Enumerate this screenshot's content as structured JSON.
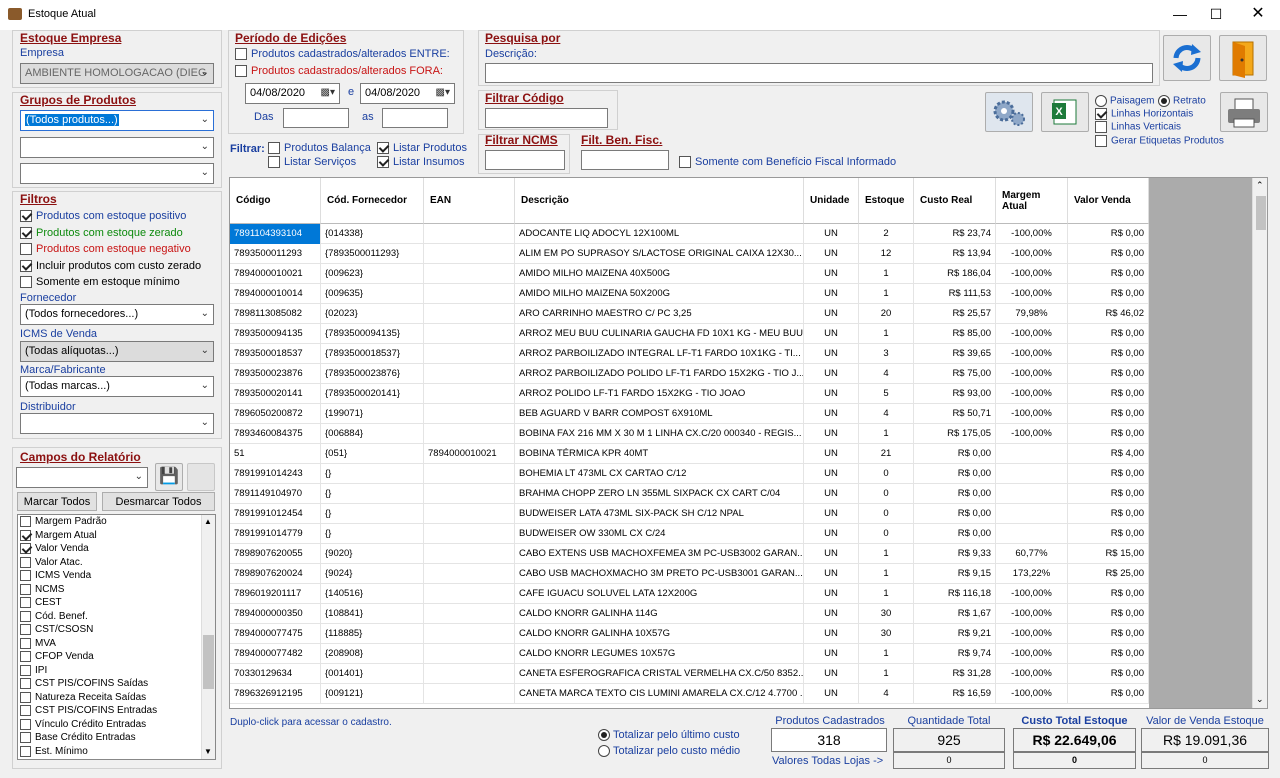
{
  "window": {
    "title": "Estoque Atual"
  },
  "empresa": {
    "section": "Estoque Empresa",
    "label": "Empresa",
    "value": "AMBIENTE HOMOLOGACAO (DIEG"
  },
  "grupos": {
    "section": "Grupos de Produtos",
    "combo1": "(Todos produtos...)",
    "combo2": "",
    "combo3": ""
  },
  "filtros": {
    "section": "Filtros",
    "items": [
      {
        "label": "Produtos com estoque positivo",
        "checked": true,
        "color": "#1a3fa0"
      },
      {
        "label": "Produtos com estoque zerado",
        "checked": true,
        "color": "#0d8a0d"
      },
      {
        "label": "Produtos com estoque negativo",
        "checked": false,
        "color": "#c81414"
      },
      {
        "label": "Incluir produtos com custo zerado",
        "checked": true,
        "color": "#000000"
      },
      {
        "label": "Somente em estoque mínimo",
        "checked": false,
        "color": "#000000"
      }
    ],
    "fornecedor_label": "Fornecedor",
    "fornecedor": "(Todos fornecedores...)",
    "icms_label": "ICMS de Venda",
    "icms": "(Todas alíquotas...)",
    "marca_label": "Marca/Fabricante",
    "marca": "(Todas marcas...)",
    "distribuidor_label": "Distribuidor",
    "distribuidor": ""
  },
  "campos": {
    "section": "Campos do Relatório",
    "marcar": "Marcar Todos",
    "desmarcar": "Desmarcar Todos",
    "items": [
      {
        "label": "Margem Padrão",
        "checked": false
      },
      {
        "label": "Margem Atual",
        "checked": true
      },
      {
        "label": "Valor Venda",
        "checked": true
      },
      {
        "label": "Valor Atac.",
        "checked": false
      },
      {
        "label": "ICMS Venda",
        "checked": false
      },
      {
        "label": "NCMS",
        "checked": false
      },
      {
        "label": "CEST",
        "checked": false
      },
      {
        "label": "Cód. Benef.",
        "checked": false
      },
      {
        "label": "CST/CSOSN",
        "checked": false
      },
      {
        "label": "MVA",
        "checked": false
      },
      {
        "label": "CFOP Venda",
        "checked": false
      },
      {
        "label": "IPI",
        "checked": false
      },
      {
        "label": "CST PIS/COFINS Saídas",
        "checked": false
      },
      {
        "label": "Natureza Receita Saídas",
        "checked": false
      },
      {
        "label": "CST PIS/COFINS Entradas",
        "checked": false
      },
      {
        "label": "Vínculo Crédito Entradas",
        "checked": false
      },
      {
        "label": "Base Crédito Entradas",
        "checked": false
      },
      {
        "label": "Est. Mínimo",
        "checked": false
      }
    ]
  },
  "periodo": {
    "section": "Período de Edições",
    "entre": "Produtos cadastrados/alterados ENTRE:",
    "fora": "Produtos cadastrados/alterados FORA:",
    "date1": "04/08/2020",
    "e": "e",
    "date2": "04/08/2020",
    "das": "Das",
    "as": "as"
  },
  "filtrar": {
    "label": "Filtrar:",
    "balanca": "Produtos Balança",
    "servicos": "Listar Serviços",
    "listar_produtos": "Listar Produtos",
    "insumos": "Listar Insumos"
  },
  "pesquisa": {
    "section": "Pesquisa por",
    "descricao_label": "Descrição:",
    "descricao": ""
  },
  "filtrar_codigo": {
    "label": "Filtrar Código",
    "value": ""
  },
  "filtrar_ncms": {
    "label": "Filtrar NCMS",
    "value": ""
  },
  "filt_ben": {
    "label": "Filt. Ben. Fisc.",
    "value": "",
    "somente": "Somente com Benefício Fiscal Informado"
  },
  "opcoes": {
    "paisagem": "Paisagem",
    "retrato": "Retrato",
    "linhas_h": "Linhas Horizontais",
    "linhas_v": "Linhas Verticais",
    "etiquetas": "Gerar Etiquetas Produtos"
  },
  "grid": {
    "headers": [
      "Código",
      "Cód. Fornecedor",
      "EAN",
      "Descrição",
      "Unidade",
      "Estoque",
      "Custo Real",
      "Margem Atual",
      "Valor Venda"
    ],
    "rows": [
      [
        "7891104393104",
        "{014338}",
        "",
        "ADOCANTE LIQ ADOCYL          12X100ML",
        "UN",
        "2",
        "R$ 23,74",
        "-100,00%",
        "R$ 0,00"
      ],
      [
        "7893500011293",
        "{7893500011293}",
        "",
        "ALIM EM PO SUPRASOY S/LACTOSE ORIGINAL CAIXA 12X30...",
        "UN",
        "12",
        "R$ 13,94",
        "-100,00%",
        "R$ 0,00"
      ],
      [
        "7894000010021",
        "{009623}",
        "",
        "AMIDO MILHO MAIZENA            40X500G",
        "UN",
        "1",
        "R$ 186,04",
        "-100,00%",
        "R$ 0,00"
      ],
      [
        "7894000010014",
        "{009635}",
        "",
        "AMIDO MILHO MAIZENA            50X200G",
        "UN",
        "1",
        "R$ 111,53",
        "-100,00%",
        "R$ 0,00"
      ],
      [
        "7898113085082",
        "{02023}",
        "",
        "ARO CARRINHO MAESTRO C/ PC 3,25",
        "UN",
        "20",
        "R$ 25,57",
        "79,98%",
        "R$ 46,02"
      ],
      [
        "7893500094135",
        "{7893500094135}",
        "",
        "ARROZ MEU BUU CULINARIA GAUCHA FD 10X1 KG - MEU BUU",
        "UN",
        "1",
        "R$ 85,00",
        "-100,00%",
        "R$ 0,00"
      ],
      [
        "7893500018537",
        "{7893500018537}",
        "",
        "ARROZ PARBOILIZADO INTEGRAL LF-T1 FARDO 10X1KG - TI...",
        "UN",
        "3",
        "R$ 39,65",
        "-100,00%",
        "R$ 0,00"
      ],
      [
        "7893500023876",
        "{7893500023876}",
        "",
        "ARROZ PARBOILIZADO POLIDO LF-T1 FARDO 15X2KG - TIO J...",
        "UN",
        "4",
        "R$ 75,00",
        "-100,00%",
        "R$ 0,00"
      ],
      [
        "7893500020141",
        "{7893500020141}",
        "",
        "ARROZ POLIDO LF-T1 FARDO 15X2KG - TIO JOAO",
        "UN",
        "5",
        "R$ 93,00",
        "-100,00%",
        "R$ 0,00"
      ],
      [
        "7896050200872",
        "{199071}",
        "",
        "BEB AGUARD V BARR  COMPOST     6X910ML",
        "UN",
        "4",
        "R$ 50,71",
        "-100,00%",
        "R$ 0,00"
      ],
      [
        "7893460084375",
        "{006884}",
        "",
        "BOBINA FAX 216 MM X 30 M 1 LINHA CX.C/20 000340 - REGIS...",
        "UN",
        "1",
        "R$ 175,05",
        "-100,00%",
        "R$ 0,00"
      ],
      [
        "51",
        "{051}",
        "7894000010021",
        "BOBINA TÉRMICA KPR 40MT",
        "UN",
        "21",
        "R$ 0,00",
        "",
        "R$ 4,00"
      ],
      [
        "7891991014243",
        "{}",
        "",
        "BOHEMIA LT 473ML CX CARTAO C/12",
        "UN",
        "0",
        "R$ 0,00",
        "",
        "R$ 0,00"
      ],
      [
        "7891149104970",
        "{}",
        "",
        "BRAHMA CHOPP ZERO LN 355ML SIXPACK CX CART C/04",
        "UN",
        "0",
        "R$ 0,00",
        "",
        "R$ 0,00"
      ],
      [
        "7891991012454",
        "{}",
        "",
        "BUDWEISER LATA 473ML SIX-PACK SH C/12 NPAL",
        "UN",
        "0",
        "R$ 0,00",
        "",
        "R$ 0,00"
      ],
      [
        "7891991014779",
        "{}",
        "",
        "BUDWEISER OW 330ML CX C/24",
        "UN",
        "0",
        "R$ 0,00",
        "",
        "R$ 0,00"
      ],
      [
        "7898907620055",
        "{9020}",
        "",
        "CABO EXTENS USB MACHOXFEMEA 3M PC-USB3002 GARAN...",
        "UN",
        "1",
        "R$ 9,33",
        "60,77%",
        "R$ 15,00"
      ],
      [
        "7898907620024",
        "{9024}",
        "",
        "CABO USB MACHOXMACHO 3M PRETO PC-USB3001 GARAN...",
        "UN",
        "1",
        "R$ 9,15",
        "173,22%",
        "R$ 25,00"
      ],
      [
        "7896019201117",
        "{140516}",
        "",
        "CAFE IGUACU SOLUVEL LATA       12X200G",
        "UN",
        "1",
        "R$ 116,18",
        "-100,00%",
        "R$ 0,00"
      ],
      [
        "7894000000350",
        "{108841}",
        "",
        "CALDO KNORR GALINHA            114G",
        "UN",
        "30",
        "R$ 1,67",
        "-100,00%",
        "R$ 0,00"
      ],
      [
        "7894000077475",
        "{118885}",
        "",
        "CALDO KNORR GALINHA            10X57G",
        "UN",
        "30",
        "R$ 9,21",
        "-100,00%",
        "R$ 0,00"
      ],
      [
        "7894000077482",
        "{208908}",
        "",
        "CALDO KNORR LEGUMES            10X57G",
        "UN",
        "1",
        "R$ 9,74",
        "-100,00%",
        "R$ 0,00"
      ],
      [
        "70330129634",
        "{001401}",
        "",
        "CANETA ESFEROGRAFICA CRISTAL VERMELHA CX.C/50 8352...",
        "UN",
        "1",
        "R$ 31,28",
        "-100,00%",
        "R$ 0,00"
      ],
      [
        "7896326912195",
        "{009121}",
        "",
        "CANETA MARCA TEXTO CIS LUMINI AMARELA CX.C/12 4.7700 ...",
        "UN",
        "4",
        "R$ 16,59",
        "-100,00%",
        "R$ 0,00"
      ]
    ]
  },
  "footer": {
    "hint": "Duplo-click para acessar o cadastro.",
    "tot_ultimo": "Totalizar pelo último custo",
    "tot_medio": "Totalizar pelo custo médio",
    "prod_label": "Produtos Cadastrados",
    "prod_val": "318",
    "qtd_label": "Quantidade Total",
    "qtd_val": "925",
    "qtd_sub": "0",
    "custo_label": "Custo Total Estoque",
    "custo_val": "R$ 22.649,06",
    "custo_sub": "0",
    "venda_label": "Valor de Venda Estoque",
    "venda_val": "R$ 19.091,36",
    "venda_sub": "0",
    "lojas": "Valores Todas Lojas ->"
  }
}
